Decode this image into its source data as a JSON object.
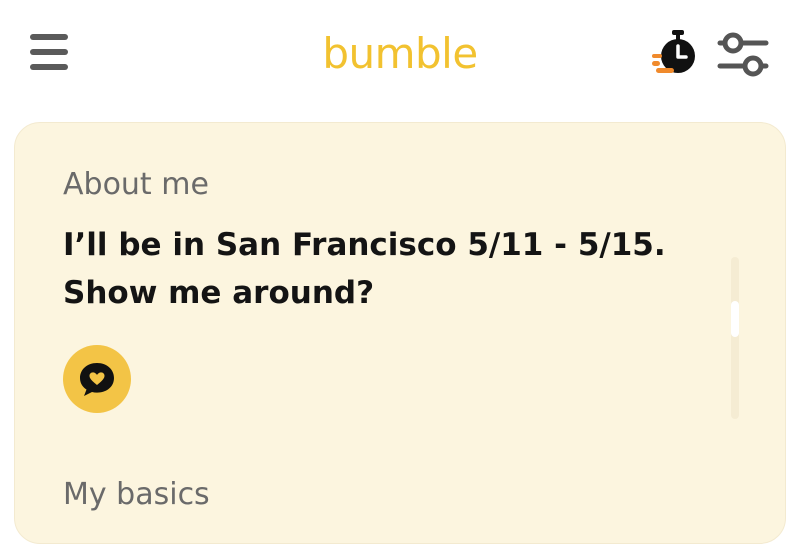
{
  "header": {
    "logo_text": "bumble",
    "menu_icon": "hamburger-menu-icon",
    "timer_icon": "stopwatch-icon",
    "filter_icon": "sliders-filter-icon"
  },
  "profile": {
    "about_label": "About me",
    "about_text": "I’ll be in San Francisco 5/11 - 5/15. Show me around?",
    "prompt_icon": "chat-heart-icon",
    "basics_label": "My basics"
  },
  "colors": {
    "brand_yellow": "#f2c230",
    "card_background": "#fcf5df",
    "timer_accent": "#f08a2c"
  }
}
